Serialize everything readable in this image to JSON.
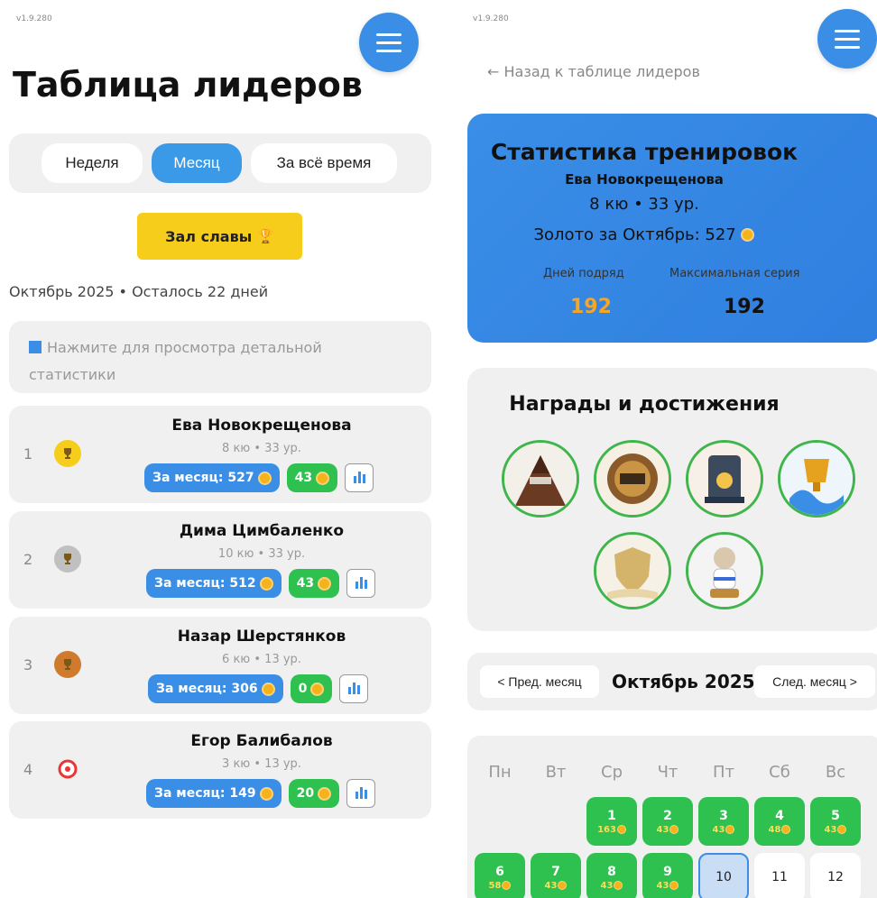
{
  "left": {
    "version": "v1.9.280",
    "title": "Таблица лидеров",
    "tabs": [
      "Неделя",
      "Месяц",
      "За всё время"
    ],
    "active_tab": "Месяц",
    "hall_of_fame": "Зал славы",
    "subline": "Октябрь 2025 • Осталось 22 дней",
    "hint": "Нажмите для просмотра детальной статистики",
    "players": [
      {
        "rank": "1",
        "name": "Ева Новокрещенова",
        "level": "8 кю • 33 ур.",
        "month": "За месяц: 527",
        "coins": "43",
        "medal_color": "#f6cd1a"
      },
      {
        "rank": "2",
        "name": "Дима Цимбаленко",
        "level": "10 кю • 33 ур.",
        "month": "За месяц: 512",
        "coins": "43",
        "medal_color": "#c0c0c0"
      },
      {
        "rank": "3",
        "name": "Назар Шерстянков",
        "level": "6 кю • 13 ур.",
        "month": "За месяц: 306",
        "coins": "0",
        "medal_color": "#d07a2e"
      },
      {
        "rank": "4",
        "name": "Егор Балибалов",
        "level": "3 кю • 13 ур.",
        "month": "За месяц: 149",
        "coins": "20",
        "medal_color": "target"
      }
    ]
  },
  "right": {
    "version": "v1.9.280",
    "back": "← Назад к таблице лидеров",
    "stats": {
      "title": "Статистика тренировок",
      "name": "Ева Новокрещенова",
      "level": "8 кю • 33 ур.",
      "gold": "Золото за Октябрь: 527",
      "streak_label": "Дней подряд",
      "streak_value": "192",
      "max_label": "Максимальная серия",
      "max_value": "192"
    },
    "achievements_title": "Награды и достижения",
    "achievements": [
      "mountain-badge",
      "medal-100-badge",
      "card-10000-badge",
      "cup-wave-badge",
      "dragon-shield-badge",
      "karate-cat-badge"
    ],
    "month_nav": {
      "prev": "< Пред. месяц",
      "title": "Октябрь 2025",
      "next": "След. месяц >"
    },
    "weekdays": [
      "Пн",
      "Вт",
      "Ср",
      "Чт",
      "Пт",
      "Сб",
      "Вс"
    ],
    "days": [
      {
        "d": "1",
        "c": "163",
        "state": "on"
      },
      {
        "d": "2",
        "c": "43",
        "state": "on"
      },
      {
        "d": "3",
        "c": "43",
        "state": "on"
      },
      {
        "d": "4",
        "c": "48",
        "state": "on"
      },
      {
        "d": "5",
        "c": "43",
        "state": "on"
      },
      {
        "d": "6",
        "c": "58",
        "state": "on"
      },
      {
        "d": "7",
        "c": "43",
        "state": "on"
      },
      {
        "d": "8",
        "c": "43",
        "state": "on"
      },
      {
        "d": "9",
        "c": "43",
        "state": "on"
      },
      {
        "d": "10",
        "c": "",
        "state": "today"
      },
      {
        "d": "11",
        "c": "",
        "state": "off"
      },
      {
        "d": "12",
        "c": "",
        "state": "off"
      }
    ],
    "colors": {
      "accent": "#3a8ee6",
      "green": "#2fc14f",
      "streak": "#f6a623"
    }
  }
}
